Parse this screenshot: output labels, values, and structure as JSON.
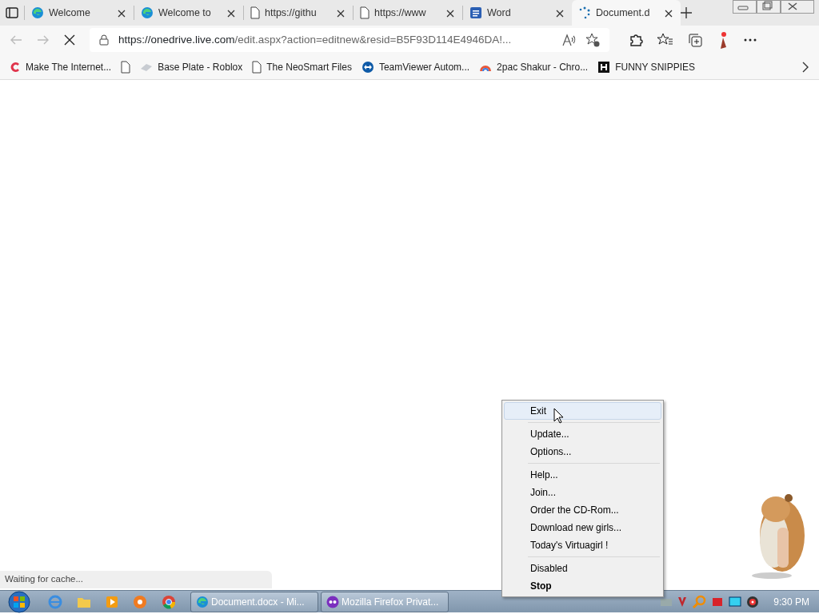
{
  "tabs": [
    {
      "title": "Welcome",
      "kind": "edge",
      "selected": false
    },
    {
      "title": "Welcome to",
      "kind": "edge",
      "selected": false
    },
    {
      "title": "https://githu",
      "kind": "page",
      "selected": false
    },
    {
      "title": "https://www",
      "kind": "page",
      "selected": false
    },
    {
      "title": "Word",
      "kind": "word",
      "selected": false
    },
    {
      "title": "Document.d",
      "kind": "loading",
      "selected": true
    }
  ],
  "address_bar": {
    "host": "https://onedrive.live.com",
    "path": "/edit.aspx?action=editnew&resid=B5F93D114E4946DA!..."
  },
  "bookmarks": [
    {
      "label": "Make The Internet...",
      "kind": "c"
    },
    {
      "kind": "page"
    },
    {
      "label": "Base Plate - Roblox",
      "kind": "plate"
    },
    {
      "label": "The NeoSmart Files",
      "kind": "page"
    },
    {
      "label": "TeamViewer Autom...",
      "kind": "tv"
    },
    {
      "label": "2pac Shakur - Chro...",
      "kind": "rainbow"
    },
    {
      "label": "FUNNY SNIPPIES",
      "kind": "h"
    }
  ],
  "status_text": "Waiting for cache...",
  "context_menu": {
    "groups": [
      [
        {
          "label": "Exit",
          "selected": true,
          "bold": false
        }
      ],
      [
        {
          "label": "Update...",
          "selected": false,
          "bold": false
        },
        {
          "label": "Options...",
          "selected": false,
          "bold": false
        }
      ],
      [
        {
          "label": "Help...",
          "selected": false,
          "bold": false
        },
        {
          "label": "Join...",
          "selected": false,
          "bold": false
        },
        {
          "label": "Order the CD-Rom...",
          "selected": false,
          "bold": false
        },
        {
          "label": "Download new girls...",
          "selected": false,
          "bold": false
        },
        {
          "label": "Today's Virtuagirl !",
          "selected": false,
          "bold": false
        }
      ],
      [
        {
          "label": "Disabled",
          "selected": false,
          "bold": false
        },
        {
          "label": "Stop",
          "selected": false,
          "bold": true
        }
      ]
    ]
  },
  "taskbar": {
    "windows": [
      {
        "title": "Document.docx - Mi...",
        "kind": "edge"
      },
      {
        "title": "Mozilla Firefox Privat...",
        "kind": "mask"
      }
    ],
    "clock": "9:30 PM"
  }
}
